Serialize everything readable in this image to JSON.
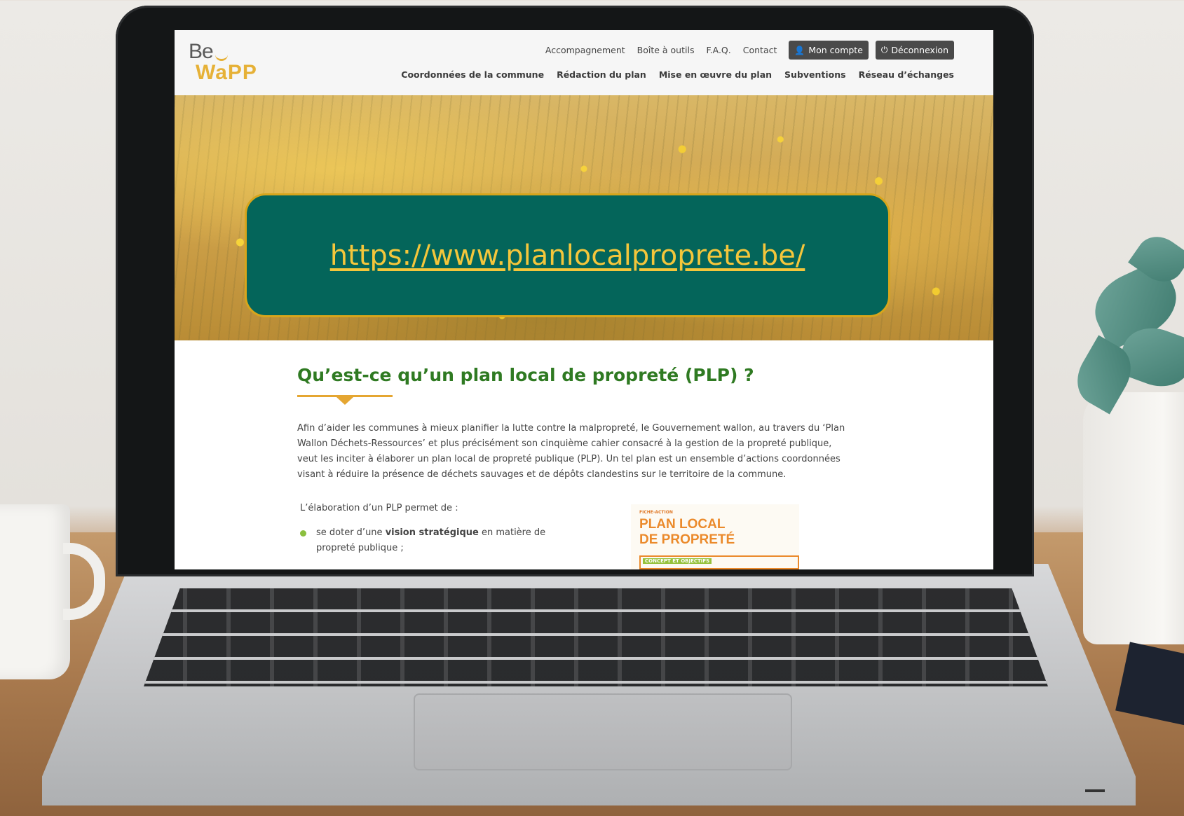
{
  "logo": {
    "line1": "Be",
    "line2": "WaPP"
  },
  "util_nav": {
    "links": [
      "Accompagnement",
      "Boîte à outils",
      "F.A.Q.",
      "Contact"
    ],
    "account_label": "Mon compte",
    "logout_label": "Déconnexion"
  },
  "main_nav": {
    "links": [
      "Coordonnées de la commune",
      "Rédaction du plan",
      "Mise en œuvre du plan",
      "Subventions",
      "Réseau d’échanges"
    ]
  },
  "hero": {
    "url": "https://www.planlocalproprete.be/"
  },
  "content": {
    "title": "Qu’est-ce qu’un plan local de propreté (PLP) ?",
    "intro": "Afin d’aider les communes à mieux planifier la lutte contre la malpropreté, le Gouvernement wallon, au travers du ‘Plan Wallon Déchets-Ressources’ et plus précisément son cinquième cahier consacré à la gestion de la propreté publique, veut les inciter à élaborer un plan local de propreté publique (PLP). Un tel plan est un ensemble d’actions coordonnées visant à réduire la présence de déchets sauvages et de dépôts clandestins sur le territoire de la commune.",
    "lead": "L’élaboration d’un PLP permet de :",
    "bullet1_pre": "se doter d’une ",
    "bullet1_bold": "vision stratégique",
    "bullet1_post": " en matière de propreté publique ;"
  },
  "doc_card": {
    "kicker": "FICHE-ACTION",
    "title_line1": "PLAN LOCAL",
    "title_line2": "DE PROPRETÉ",
    "band": "CONCEPT ET OBJECTIFS"
  },
  "colors": {
    "brand_yellow": "#e6b137",
    "title_green": "#2f7a22",
    "url_box": "#04655a",
    "url_text": "#f4c63b",
    "bullet_dot": "#8bbf3f",
    "doc_orange": "#eb8a2b"
  },
  "icons": {
    "account": "user-icon",
    "logout": "power-icon"
  }
}
